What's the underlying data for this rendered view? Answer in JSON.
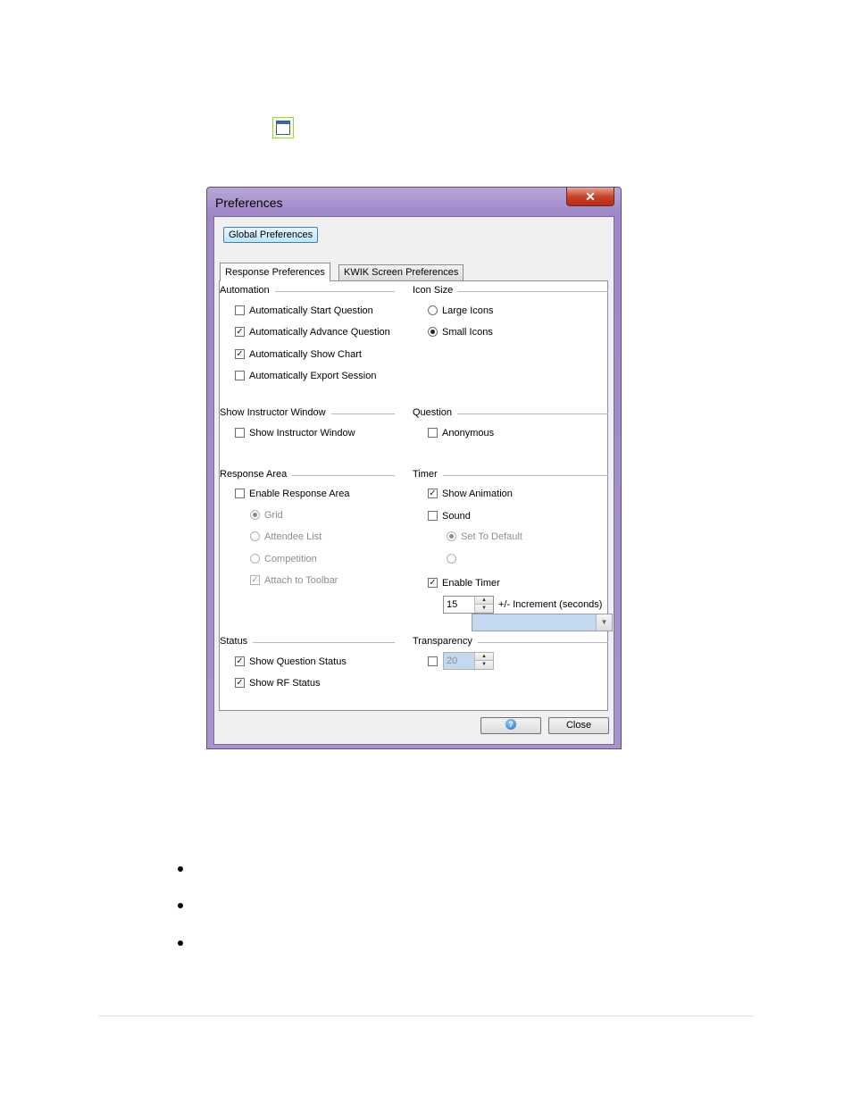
{
  "window": {
    "title": "Preferences",
    "close_glyph": "✕",
    "global_button": "Global Preferences"
  },
  "tabs": [
    "Response Preferences",
    "KWIK Screen Preferences"
  ],
  "sections": {
    "automation": "Automation",
    "icon_size": "Icon Size",
    "show_instructor": "Show Instructor Window",
    "question": "Question",
    "response_area": "Response Area",
    "timer": "Timer",
    "status": "Status",
    "transparency": "Transparency"
  },
  "automation": {
    "start": {
      "label": "Automatically Start Question",
      "checked": false
    },
    "advance": {
      "label": "Automatically Advance Question",
      "checked": true
    },
    "chart": {
      "label": "Automatically Show Chart",
      "checked": true
    },
    "export": {
      "label": "Automatically Export Session",
      "checked": false
    }
  },
  "icon_size": {
    "large": {
      "label": "Large Icons",
      "selected": false
    },
    "small": {
      "label": "Small Icons",
      "selected": true
    }
  },
  "instructor": {
    "label": "Show Instructor Window",
    "checked": false
  },
  "question": {
    "label": "Anonymous",
    "checked": false
  },
  "response_area": {
    "enable": {
      "label": "Enable Response Area",
      "checked": false
    },
    "grid": {
      "label": "Grid",
      "selected": true
    },
    "attendee": {
      "label": "Attendee List",
      "selected": false
    },
    "competition": {
      "label": "Competition",
      "selected": false
    },
    "toolbar": {
      "label": "Attach to Toolbar",
      "checked": true
    }
  },
  "timer": {
    "animation": {
      "label": "Show Animation",
      "checked": true
    },
    "sound": {
      "label": "Sound",
      "checked": false
    },
    "default": {
      "label": "Set To Default",
      "selected": true
    },
    "enable": {
      "label": "Enable Timer",
      "checked": true
    },
    "increment_value": "15",
    "increment_label": "+/- Increment (seconds)"
  },
  "status": {
    "question": {
      "label": "Show Question Status",
      "checked": true
    },
    "rf": {
      "label": "Show RF Status",
      "checked": true
    }
  },
  "transparency": {
    "checked": false,
    "value": "20"
  },
  "buttons": {
    "help": "?",
    "close": "Close"
  },
  "icons": {
    "spin_up": "▲",
    "spin_down": "▼",
    "combo_arrow": "▼",
    "check": "✓"
  }
}
